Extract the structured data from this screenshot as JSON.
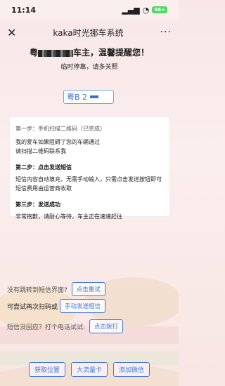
{
  "status": {
    "time": "11:14",
    "battery": "56+"
  },
  "nav": {
    "title": "kaka时光挪车系统",
    "close": "✕",
    "more": "···"
  },
  "headline": {
    "prefix": "粤",
    "suffix": "车主，温馨提醒您！",
    "sub": "临时停靠，请多关照"
  },
  "plate": {
    "text": "粤B 2"
  },
  "card": {
    "step1": "第一步：手机扫描二维码（已完成）",
    "line1": "我的爱车如果阻碍了您的车辆通过",
    "line2": "请扫描二维码联系我",
    "step2": "第二步：点击发送短信",
    "line3": "短信内容自动填充，无需手动输入，只需点击发送按钮即可",
    "line4": "短信费用由运营商收取",
    "step3": "第三步：发送成功",
    "line5": "非常抱歉，请耐心等待，车主正在速速赶往"
  },
  "rows": {
    "q1": "没有跳转到短信界面?",
    "b1": "点击重试",
    "q2": "可尝试再次扫码或",
    "b2": "手动发送短信",
    "q3": "短信没回应？打个电话试试:",
    "b3": "点击拨打"
  },
  "bottom": {
    "b1": "获取位置",
    "b2": "大流量卡",
    "b3": "添加微信"
  }
}
